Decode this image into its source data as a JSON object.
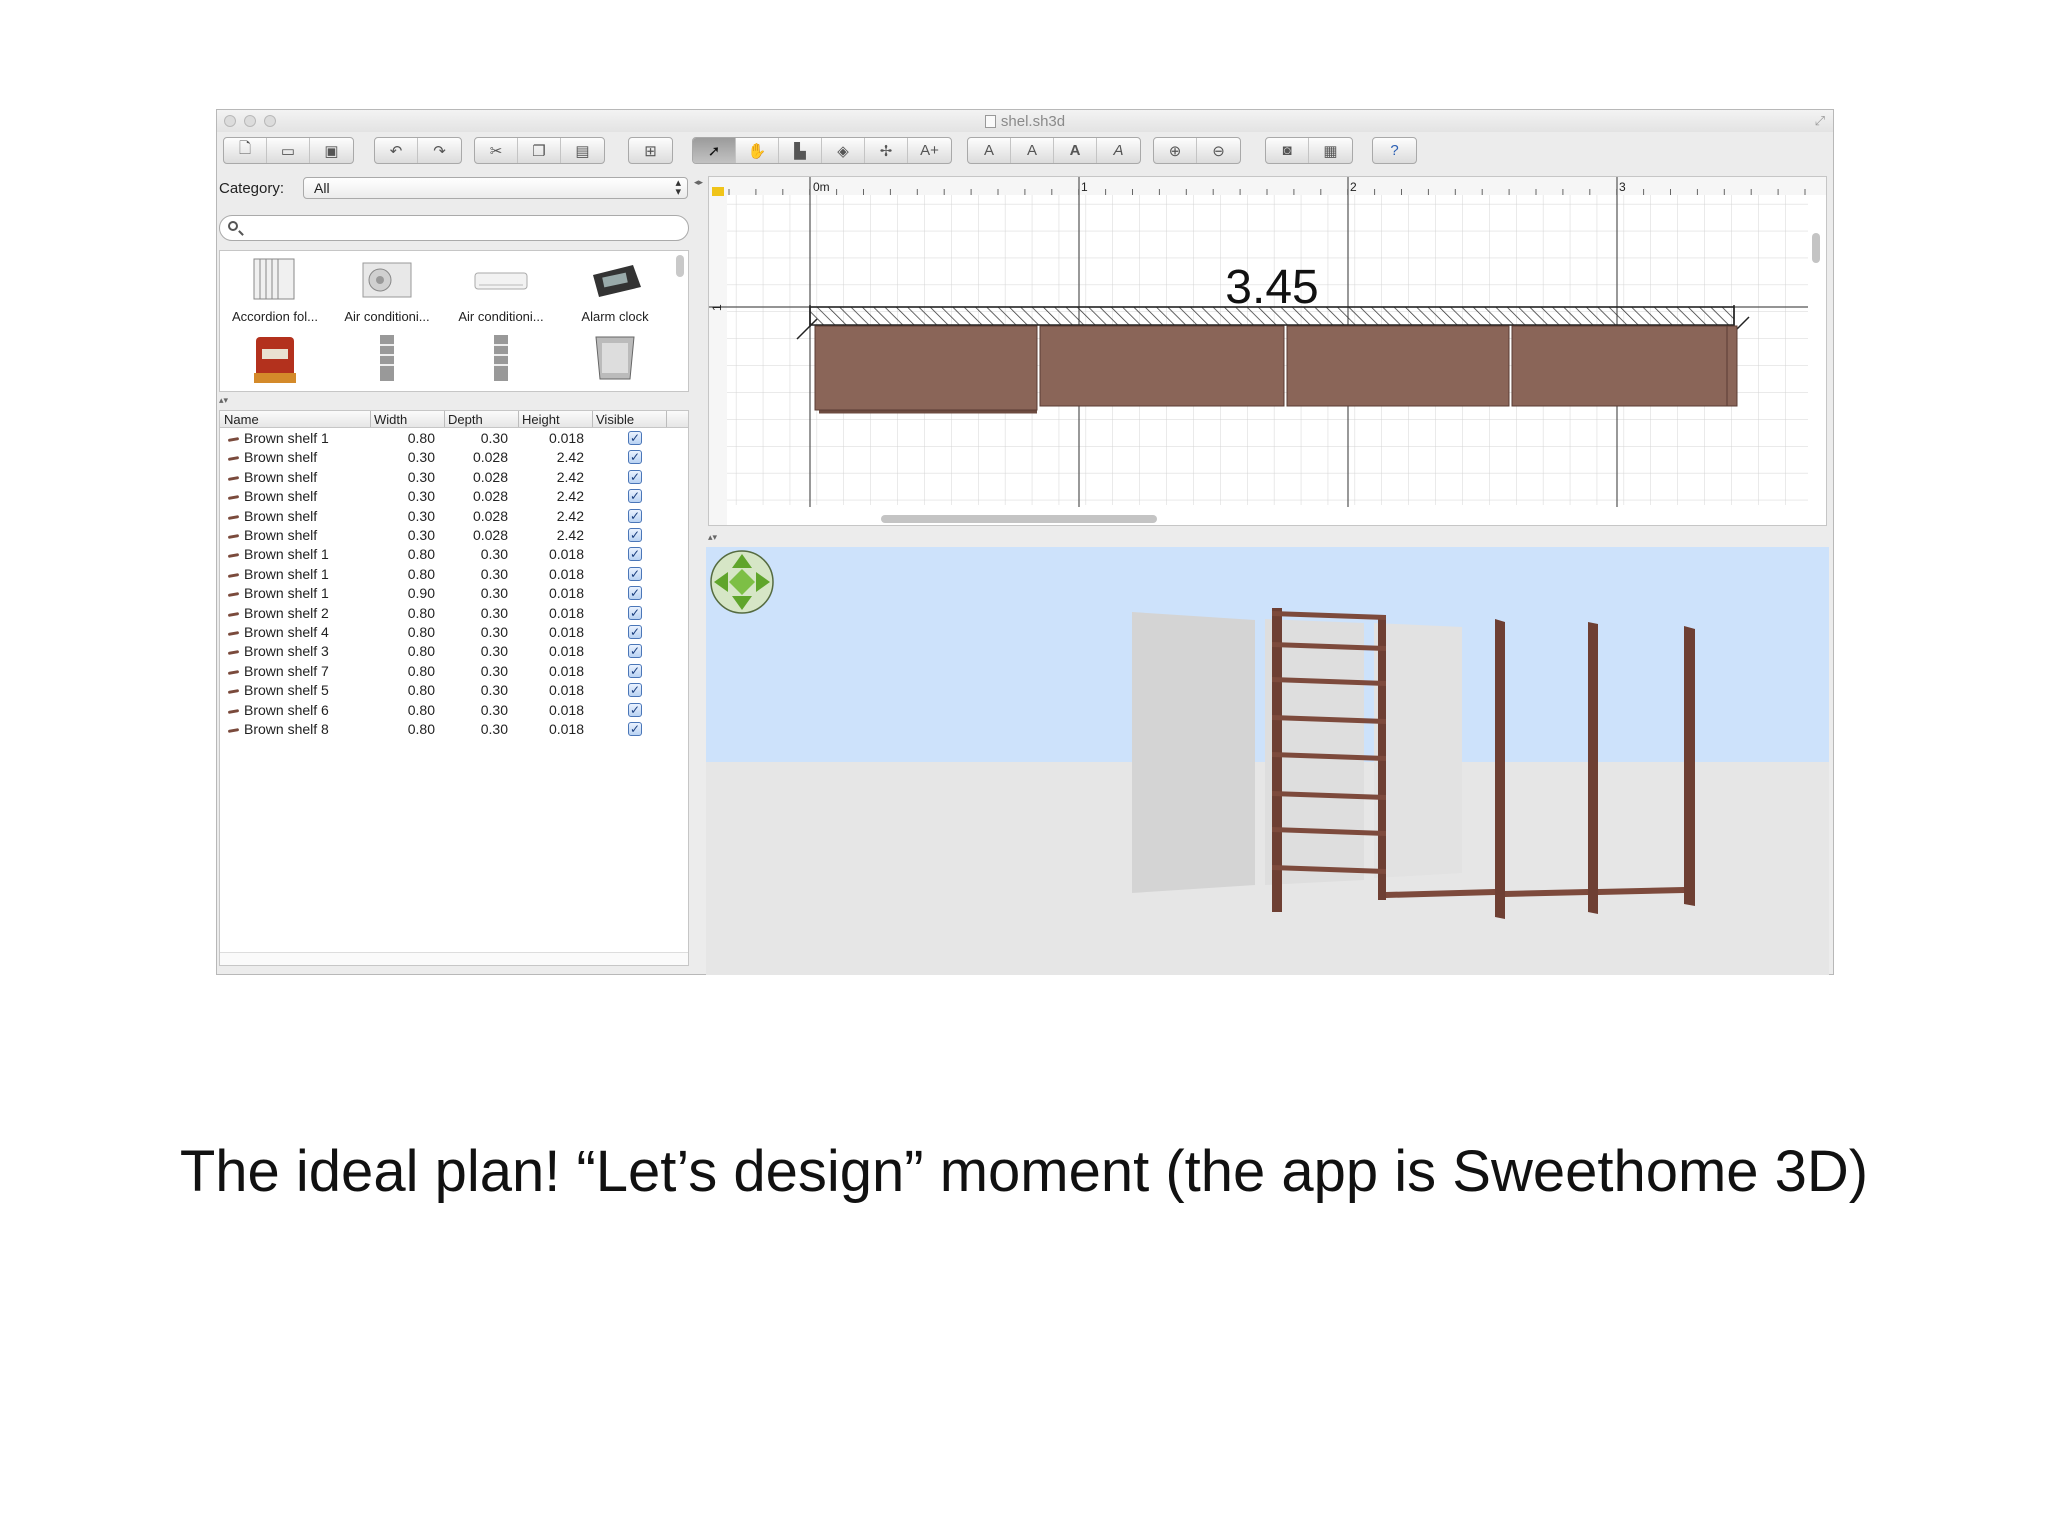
{
  "window": {
    "title": "shel.sh3d"
  },
  "toolbar": {
    "groups": [
      [
        "new-icon",
        "open-icon",
        "save-icon"
      ],
      [
        "undo-icon",
        "redo-icon"
      ],
      [
        "cut-icon",
        "copy-icon",
        "paste-icon"
      ],
      [
        "add-furniture-icon"
      ],
      [
        "select-icon",
        "pan-icon",
        "create-walls-icon",
        "create-rooms-icon",
        "create-dimensions-icon",
        "add-text-icon"
      ],
      [
        "increase-text-icon",
        "decrease-text-icon",
        "bold-text-icon",
        "italic-text-icon"
      ],
      [
        "zoom-in-icon",
        "zoom-out-icon"
      ],
      [
        "create-photo-icon",
        "create-video-icon"
      ],
      [
        "help-icon"
      ]
    ],
    "active": "select-icon"
  },
  "catalog": {
    "category_label": "Category:",
    "category_value": "All",
    "search_placeholder": "",
    "items": [
      {
        "label": "Accordion fol..."
      },
      {
        "label": "Air conditioni..."
      },
      {
        "label": "Air conditioni..."
      },
      {
        "label": "Alarm clock"
      }
    ]
  },
  "furniture_table": {
    "columns": [
      "Name",
      "Width",
      "Depth",
      "Height",
      "Visible"
    ],
    "rows": [
      {
        "name": "Brown shelf 1",
        "width": "0.80",
        "depth": "0.30",
        "height": "0.018",
        "visible": true
      },
      {
        "name": "Brown shelf",
        "width": "0.30",
        "depth": "0.028",
        "height": "2.42",
        "visible": true
      },
      {
        "name": "Brown shelf",
        "width": "0.30",
        "depth": "0.028",
        "height": "2.42",
        "visible": true
      },
      {
        "name": "Brown shelf",
        "width": "0.30",
        "depth": "0.028",
        "height": "2.42",
        "visible": true
      },
      {
        "name": "Brown shelf",
        "width": "0.30",
        "depth": "0.028",
        "height": "2.42",
        "visible": true
      },
      {
        "name": "Brown shelf",
        "width": "0.30",
        "depth": "0.028",
        "height": "2.42",
        "visible": true
      },
      {
        "name": "Brown shelf 1",
        "width": "0.80",
        "depth": "0.30",
        "height": "0.018",
        "visible": true
      },
      {
        "name": "Brown shelf 1",
        "width": "0.80",
        "depth": "0.30",
        "height": "0.018",
        "visible": true
      },
      {
        "name": "Brown shelf 1",
        "width": "0.90",
        "depth": "0.30",
        "height": "0.018",
        "visible": true
      },
      {
        "name": "Brown shelf 2",
        "width": "0.80",
        "depth": "0.30",
        "height": "0.018",
        "visible": true
      },
      {
        "name": "Brown shelf 4",
        "width": "0.80",
        "depth": "0.30",
        "height": "0.018",
        "visible": true
      },
      {
        "name": "Brown shelf 3",
        "width": "0.80",
        "depth": "0.30",
        "height": "0.018",
        "visible": true
      },
      {
        "name": "Brown shelf 7",
        "width": "0.80",
        "depth": "0.30",
        "height": "0.018",
        "visible": true
      },
      {
        "name": "Brown shelf 5",
        "width": "0.80",
        "depth": "0.30",
        "height": "0.018",
        "visible": true
      },
      {
        "name": "Brown shelf 6",
        "width": "0.80",
        "depth": "0.30",
        "height": "0.018",
        "visible": true
      },
      {
        "name": "Brown shelf 8",
        "width": "0.80",
        "depth": "0.30",
        "height": "0.018",
        "visible": true
      }
    ]
  },
  "plan": {
    "ruler_labels": [
      "0m",
      "1",
      "2",
      "3"
    ],
    "vertical_ruler_label": "1",
    "dimension_label": "3.45",
    "colors": {
      "shelf": "#8a6558",
      "grid": "#d4d4d4",
      "major_grid": "#555555"
    }
  },
  "view3d": {
    "navigator": "navigation-arrows-icon",
    "colors": {
      "sky": "#cde2fb",
      "ground": "#e6e6e6",
      "wood": "#6e3f33",
      "panel": "#d6d6d6"
    }
  },
  "caption": "The ideal plan! “Let’s design” moment (the app is Sweethome 3D)"
}
